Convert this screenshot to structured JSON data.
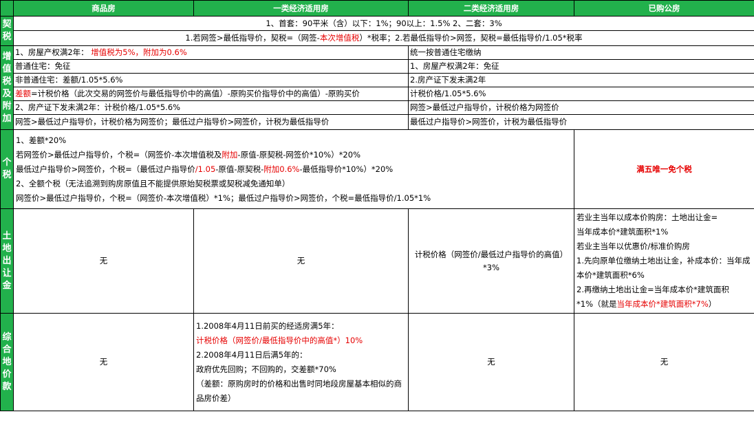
{
  "headers": {
    "blank": "",
    "col1": "商品房",
    "col2": "一类经济适用房",
    "col3": "二类经济适用房",
    "col4": "已购公房"
  },
  "rows": {
    "deed": {
      "label": "契税",
      "line1": "1、首套：90平米（含）以下：1%；90以上：1.5%          2、二套：3%",
      "line2_a": "1.若网签>最低指导价，契税=（网签-",
      "line2_red": "本次增值税",
      "line2_b": "）*税率；2.若最低指导价>网签，契税=最低指导价/1.05*税率"
    },
    "vat": {
      "label": "增值税及附加",
      "left": {
        "l1_a": "1、房屋产权满2年：     ",
        "l1_red": "增值税为5%，附加为0.6%",
        "l2": "普通住宅：免征",
        "l3": "非普通住宅：差额/1.05*5.6%",
        "l4_red": "差额",
        "l4_b": "=计税价格（此次交易的网签价与最低指导价中的高值）-原购买价指导价中的高值）-原购买价",
        "l5": "2、房产证下发未满2年：计税价格/1.05*5.6%",
        "l6": "网签>最低过户指导价，计税价格为网签价；最低过户指导价>网签价，计税为最低指导价"
      },
      "right": {
        "r1": "统一按普通住宅缴纳",
        "r2": "1、房屋产权满2年：免征",
        "r3": "2.房产证下发未满2年",
        "r4": "计税价格/1.05*5.6%",
        "r5": "网签>最低过户指导价，计税价格为网签价",
        "r6": "最低过户指导价>网签价，计税为最低指导价"
      }
    },
    "pit": {
      "label": "个税",
      "l1": "1、差额*20%",
      "l2_a": "若网签价>最低过户指导价，个税=（网签价-本次增值税及",
      "l2_red": "附加",
      "l2_b": "-原值-原契税-网签价*10%）*20%",
      "l3_a": "最低过户指导价>网签价，个税=（最低过户指导价",
      "l3_red1": "/1.05",
      "l3_b": "-原值-原契税-",
      "l3_red2": "附加0.6%",
      "l3_c": "-最低指导价*10%）*20%",
      "l4": "2、全额个税（无法追溯到购房原值且不能提供原始契税票或契税减免通知单）",
      "l5": "网签价>最低过户指导价，个税=（网签价-本次增值税）*1%；最低过户指导价>网签价，个税=最低指导价/1.05*1%",
      "right_red": "满五唯一免个税"
    },
    "land": {
      "label": "土地出让金",
      "c1": "无",
      "c2": "无",
      "c3": "计税价格（网签价/最低过户指导价的高值）*3%",
      "c4_l1": "若业主当年以成本价购房：土地出让金=",
      "c4_l2": "当年成本价*建筑面积*1%",
      "c4_l3": "若业主当年以优惠价/标准价购房",
      "c4_l4": "1.先向原单位缴纳土地出让金，补成本价：当年成本价*建筑面积*6%",
      "c4_l5": "2.再缴纳土地出让金=当年成本价*建筑面积",
      "c4_l6_a": "*1%（就是",
      "c4_l6_red": "当年成本价*建筑面积*7%",
      "c4_l6_b": "）"
    },
    "comprehensive": {
      "label": "综合地价款",
      "c1": "无",
      "c2_l1": "1.2008年4月11日前买的经适房满5年：",
      "c2_l2_red": "计税价格（网签价/最低指导价中的高值*）10%",
      "c2_l3": "2.2008年4月11日后满5年的：",
      "c2_l4": "政府优先回购；不回购的，交差额*70%",
      "c2_l5": "（差额：原购房时的价格和出售时同地段房屋基本相似的商品房价差）",
      "c3": "无",
      "c4": "无"
    }
  },
  "colors": {
    "header_green": "#22b14c",
    "accent_red": "#e60000"
  }
}
